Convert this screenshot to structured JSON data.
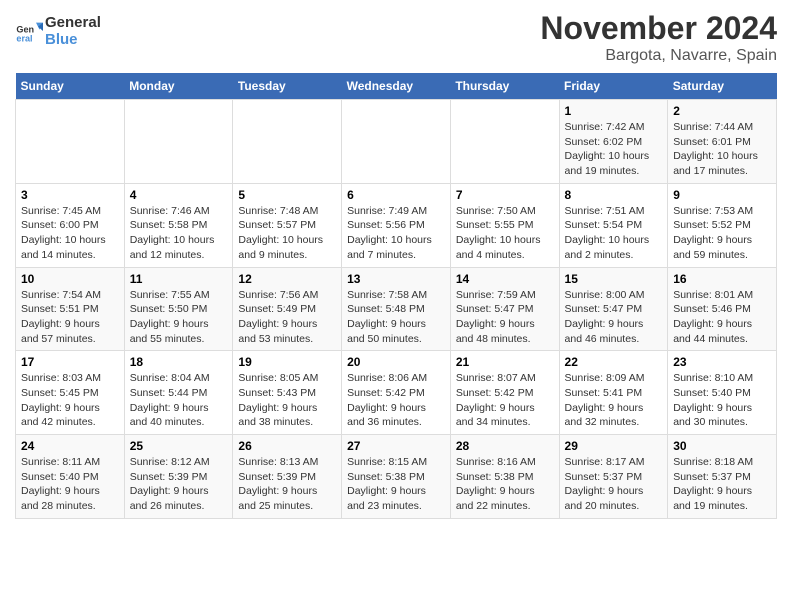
{
  "logo": {
    "text_general": "General",
    "text_blue": "Blue"
  },
  "header": {
    "month_year": "November 2024",
    "location": "Bargota, Navarre, Spain"
  },
  "weekdays": [
    "Sunday",
    "Monday",
    "Tuesday",
    "Wednesday",
    "Thursday",
    "Friday",
    "Saturday"
  ],
  "weeks": [
    [
      {
        "day": "",
        "info": ""
      },
      {
        "day": "",
        "info": ""
      },
      {
        "day": "",
        "info": ""
      },
      {
        "day": "",
        "info": ""
      },
      {
        "day": "",
        "info": ""
      },
      {
        "day": "1",
        "info": "Sunrise: 7:42 AM\nSunset: 6:02 PM\nDaylight: 10 hours and 19 minutes."
      },
      {
        "day": "2",
        "info": "Sunrise: 7:44 AM\nSunset: 6:01 PM\nDaylight: 10 hours and 17 minutes."
      }
    ],
    [
      {
        "day": "3",
        "info": "Sunrise: 7:45 AM\nSunset: 6:00 PM\nDaylight: 10 hours and 14 minutes."
      },
      {
        "day": "4",
        "info": "Sunrise: 7:46 AM\nSunset: 5:58 PM\nDaylight: 10 hours and 12 minutes."
      },
      {
        "day": "5",
        "info": "Sunrise: 7:48 AM\nSunset: 5:57 PM\nDaylight: 10 hours and 9 minutes."
      },
      {
        "day": "6",
        "info": "Sunrise: 7:49 AM\nSunset: 5:56 PM\nDaylight: 10 hours and 7 minutes."
      },
      {
        "day": "7",
        "info": "Sunrise: 7:50 AM\nSunset: 5:55 PM\nDaylight: 10 hours and 4 minutes."
      },
      {
        "day": "8",
        "info": "Sunrise: 7:51 AM\nSunset: 5:54 PM\nDaylight: 10 hours and 2 minutes."
      },
      {
        "day": "9",
        "info": "Sunrise: 7:53 AM\nSunset: 5:52 PM\nDaylight: 9 hours and 59 minutes."
      }
    ],
    [
      {
        "day": "10",
        "info": "Sunrise: 7:54 AM\nSunset: 5:51 PM\nDaylight: 9 hours and 57 minutes."
      },
      {
        "day": "11",
        "info": "Sunrise: 7:55 AM\nSunset: 5:50 PM\nDaylight: 9 hours and 55 minutes."
      },
      {
        "day": "12",
        "info": "Sunrise: 7:56 AM\nSunset: 5:49 PM\nDaylight: 9 hours and 53 minutes."
      },
      {
        "day": "13",
        "info": "Sunrise: 7:58 AM\nSunset: 5:48 PM\nDaylight: 9 hours and 50 minutes."
      },
      {
        "day": "14",
        "info": "Sunrise: 7:59 AM\nSunset: 5:47 PM\nDaylight: 9 hours and 48 minutes."
      },
      {
        "day": "15",
        "info": "Sunrise: 8:00 AM\nSunset: 5:47 PM\nDaylight: 9 hours and 46 minutes."
      },
      {
        "day": "16",
        "info": "Sunrise: 8:01 AM\nSunset: 5:46 PM\nDaylight: 9 hours and 44 minutes."
      }
    ],
    [
      {
        "day": "17",
        "info": "Sunrise: 8:03 AM\nSunset: 5:45 PM\nDaylight: 9 hours and 42 minutes."
      },
      {
        "day": "18",
        "info": "Sunrise: 8:04 AM\nSunset: 5:44 PM\nDaylight: 9 hours and 40 minutes."
      },
      {
        "day": "19",
        "info": "Sunrise: 8:05 AM\nSunset: 5:43 PM\nDaylight: 9 hours and 38 minutes."
      },
      {
        "day": "20",
        "info": "Sunrise: 8:06 AM\nSunset: 5:42 PM\nDaylight: 9 hours and 36 minutes."
      },
      {
        "day": "21",
        "info": "Sunrise: 8:07 AM\nSunset: 5:42 PM\nDaylight: 9 hours and 34 minutes."
      },
      {
        "day": "22",
        "info": "Sunrise: 8:09 AM\nSunset: 5:41 PM\nDaylight: 9 hours and 32 minutes."
      },
      {
        "day": "23",
        "info": "Sunrise: 8:10 AM\nSunset: 5:40 PM\nDaylight: 9 hours and 30 minutes."
      }
    ],
    [
      {
        "day": "24",
        "info": "Sunrise: 8:11 AM\nSunset: 5:40 PM\nDaylight: 9 hours and 28 minutes."
      },
      {
        "day": "25",
        "info": "Sunrise: 8:12 AM\nSunset: 5:39 PM\nDaylight: 9 hours and 26 minutes."
      },
      {
        "day": "26",
        "info": "Sunrise: 8:13 AM\nSunset: 5:39 PM\nDaylight: 9 hours and 25 minutes."
      },
      {
        "day": "27",
        "info": "Sunrise: 8:15 AM\nSunset: 5:38 PM\nDaylight: 9 hours and 23 minutes."
      },
      {
        "day": "28",
        "info": "Sunrise: 8:16 AM\nSunset: 5:38 PM\nDaylight: 9 hours and 22 minutes."
      },
      {
        "day": "29",
        "info": "Sunrise: 8:17 AM\nSunset: 5:37 PM\nDaylight: 9 hours and 20 minutes."
      },
      {
        "day": "30",
        "info": "Sunrise: 8:18 AM\nSunset: 5:37 PM\nDaylight: 9 hours and 19 minutes."
      }
    ]
  ]
}
